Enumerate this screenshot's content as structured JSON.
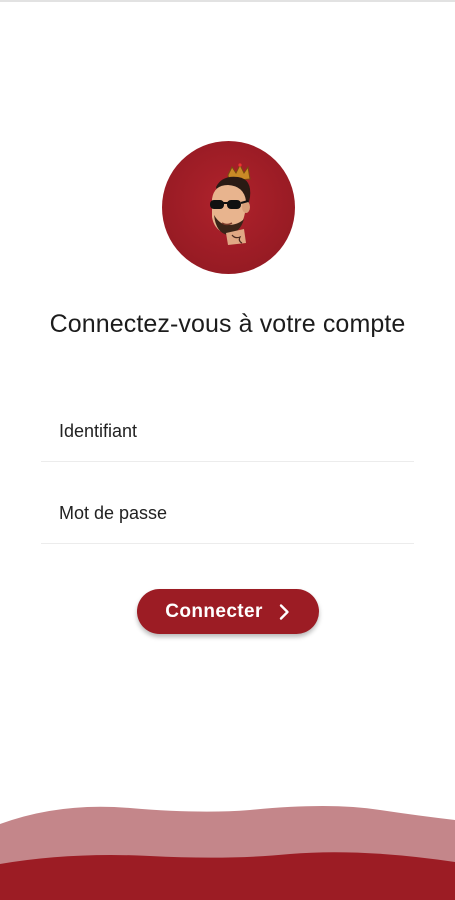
{
  "header": {
    "title": "Connectez-vous à votre compte"
  },
  "avatar": {
    "icon": "profile-avatar-crowned-man"
  },
  "form": {
    "username_placeholder": "Identifiant",
    "username_value": "",
    "password_placeholder": "Mot de passe",
    "password_value": ""
  },
  "actions": {
    "login_label": "Connecter",
    "login_icon": "chevron-right-icon"
  },
  "theme": {
    "accent": "#9c1c24",
    "wave_light": "#c4868a",
    "background": "#ffffff"
  }
}
